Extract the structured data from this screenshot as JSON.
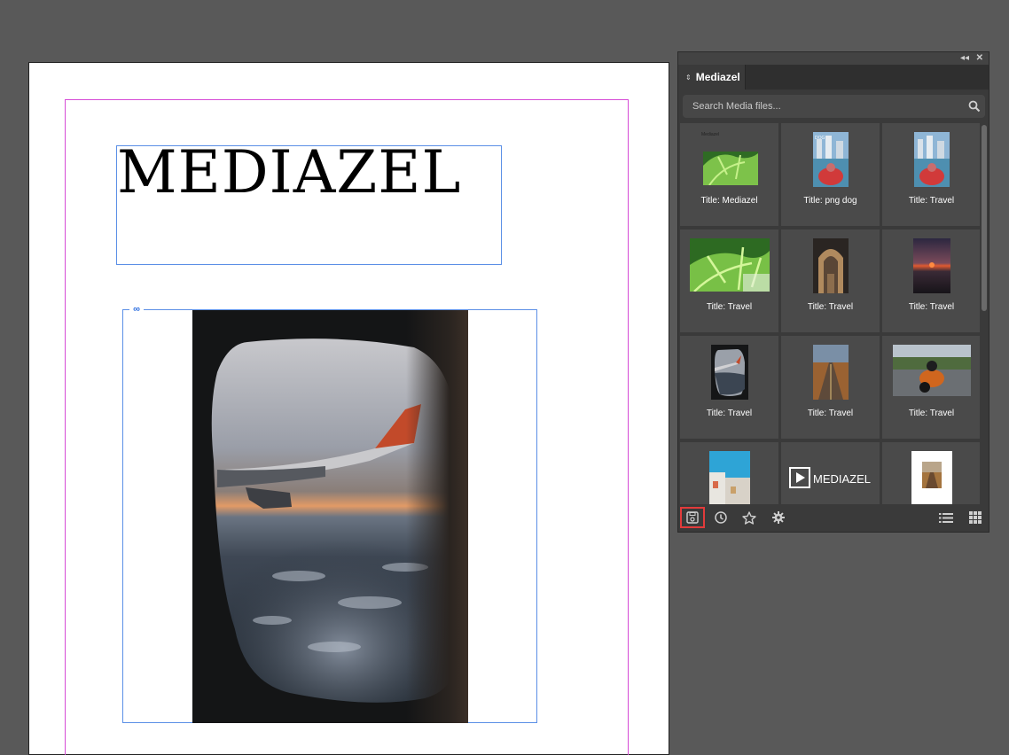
{
  "document": {
    "headline": "MEDIAZEL"
  },
  "panel": {
    "tab_label": "Mediazel",
    "search": {
      "placeholder": "Search Media files..."
    },
    "tiles": [
      {
        "caption": "Title: Mediazel",
        "thumb": "palm-leaves",
        "overlay_text": "Mediazel"
      },
      {
        "caption": "Title: png dog",
        "thumb": "boat-city"
      },
      {
        "caption": "Title: Travel",
        "thumb": "boat-city"
      },
      {
        "caption": "Title: Travel",
        "thumb": "palm-leaves-large"
      },
      {
        "caption": "Title: Travel",
        "thumb": "archway"
      },
      {
        "caption": "Title: Travel",
        "thumb": "sunset"
      },
      {
        "caption": "Title: Travel",
        "thumb": "airplane-window"
      },
      {
        "caption": "Title: Travel",
        "thumb": "road"
      },
      {
        "caption": "Title: Travel",
        "thumb": "motorcycle"
      },
      {
        "caption": "",
        "thumb": "street"
      },
      {
        "caption": "",
        "thumb": "mediazel-logo",
        "logo_text": "MEDIAZEL"
      },
      {
        "caption": "",
        "thumb": "framed-road"
      }
    ],
    "toolbar": {
      "buttons": [
        "save-icon",
        "history-icon",
        "star-icon",
        "settings-icon"
      ],
      "view_buttons": [
        "list-view-icon",
        "grid-view-icon"
      ],
      "active": "save-icon",
      "active_outline_color": "#e23b3b"
    }
  },
  "colors": {
    "workspace": "#595959",
    "margin_guide": "#d64bd6",
    "frame_outline": "#5b8fe6",
    "panel_bg": "#3a3a3a",
    "tile_bg": "#4a4a4a"
  }
}
